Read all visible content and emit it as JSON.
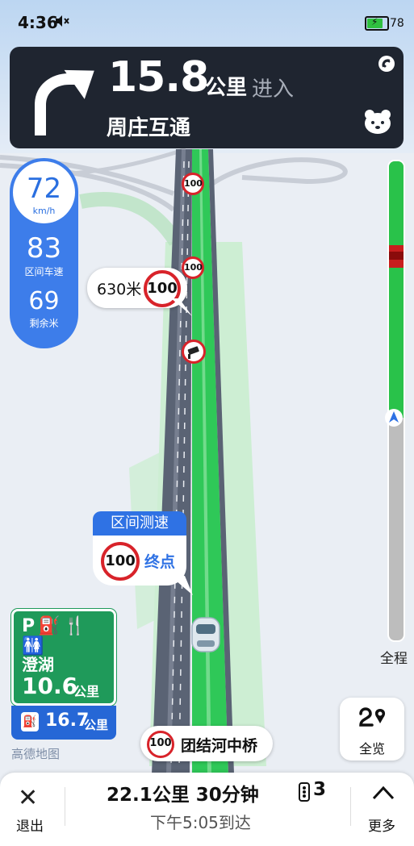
{
  "status_bar": {
    "time": "4:36",
    "battery": "78"
  },
  "navigation": {
    "distance": "15.8",
    "distance_unit": "公里",
    "action": "进入",
    "road_name": "周庄互通"
  },
  "speed_panel": {
    "current_speed": "72",
    "current_unit": "km/h",
    "average_speed": "83",
    "average_label": "区间车速",
    "remaining": "69",
    "remaining_label": "剩余米"
  },
  "map": {
    "road_limits": [
      "100",
      "100"
    ],
    "callout_distance": {
      "text": "630米",
      "limit": "100"
    },
    "section_callout": {
      "title": "区间测速",
      "limit": "100",
      "label": "终点"
    },
    "current_road": {
      "limit": "100",
      "name": "团结河中桥"
    },
    "brand": "高德地图"
  },
  "exit_sign": {
    "icons": "P⛽🍴🚻",
    "name": "澄湖",
    "distance": "10.6",
    "distance_unit": "公里",
    "service_distance": "16.7",
    "service_unit": "公里"
  },
  "progress": {
    "label": "全程",
    "fraction_completed": 0.54
  },
  "overview": {
    "label": "全览"
  },
  "bottom_bar": {
    "exit_label": "退出",
    "summary": "22.1公里 30分钟",
    "traffic_lights": "3",
    "eta": "下午5:05到达",
    "more_label": "更多"
  },
  "colors": {
    "route_green": "#29c24a",
    "nav_dark": "#1f2530",
    "accent_blue": "#2f72e4",
    "limit_red": "#d8232a",
    "exit_green": "#1f9a5a"
  }
}
